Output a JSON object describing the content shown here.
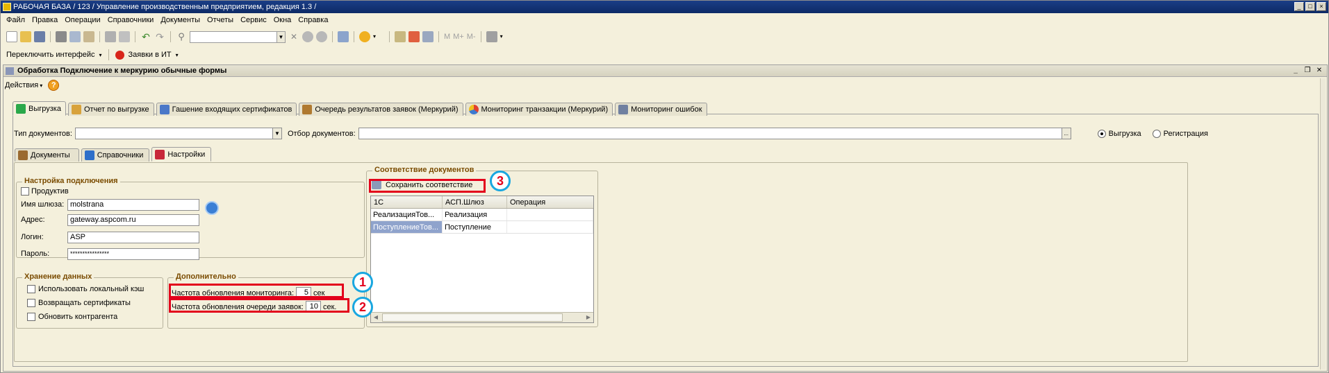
{
  "window": {
    "title": "РАБОЧАЯ БАЗА / 123 / Управление производственным предприятием, редакция 1.3 /"
  },
  "menu": [
    "Файл",
    "Правка",
    "Операции",
    "Справочники",
    "Документы",
    "Отчеты",
    "Сервис",
    "Окна",
    "Справка"
  ],
  "toolbar2": {
    "switch_interface": "Переключить интерфейс",
    "requests_it": "Заявки в ИТ"
  },
  "toolbar_disabled": {
    "m": "M",
    "mplus": "M+",
    "mminus": "M-"
  },
  "document": {
    "title": "Обработка  Подключение к меркурию обычные формы",
    "actions_label": "Действия"
  },
  "top_tabs": [
    {
      "label": "Выгрузка",
      "icon": "export-icon",
      "color": "#2aa84a"
    },
    {
      "label": "Отчет по выгрузке",
      "icon": "report-icon",
      "color": "#d8a23b"
    },
    {
      "label": "Гашение входящих сертификатов",
      "icon": "certificates-icon",
      "color": "#4b78c8"
    },
    {
      "label": "Очередь результатов заявок (Меркурий)",
      "icon": "queue-icon",
      "color": "#b07a30"
    },
    {
      "label": "Мониторинг транзакции (Меркурий)",
      "icon": "pie-chart-icon",
      "color": "#e04030"
    },
    {
      "label": "Мониторинг ошибок",
      "icon": "monitor-icon",
      "color": "#7080a0"
    }
  ],
  "filters": {
    "doc_type_label": "Тип документов:",
    "doc_type_value": "",
    "doc_filter_label": "Отбор документов:",
    "doc_filter_value": "",
    "radio_export": "Выгрузка",
    "radio_register": "Регистрация",
    "selected": "export"
  },
  "sub_tabs": [
    {
      "label": "Документы",
      "icon": "briefcase-icon",
      "color": "#9a6a30"
    },
    {
      "label": "Справочники",
      "icon": "directory-icon",
      "color": "#2e6fc9"
    },
    {
      "label": "Настройки",
      "icon": "settings-icon",
      "color": "#c8283a"
    }
  ],
  "connection": {
    "group_title": "Настройка подключения",
    "productive_label": "Продуктив",
    "productive_checked": false,
    "gateway_label": "Имя шлюза:",
    "gateway_value": "molstrana",
    "address_label": "Адрес:",
    "address_value": "gateway.aspcom.ru",
    "login_label": "Логин:",
    "login_value": "ASP",
    "password_label": "Пароль:",
    "password_value": "****************"
  },
  "storage": {
    "group_title": "Хранение данных",
    "items": [
      {
        "label": "Использовать локальный кэш",
        "checked": false
      },
      {
        "label": "Возвращать сертификаты",
        "checked": false
      },
      {
        "label": "Обновить контрагента",
        "checked": false
      }
    ]
  },
  "additional": {
    "group_title": "Дополнительно",
    "monitor_freq_label": "Частота обновления мониторинга:",
    "monitor_freq_value": "5",
    "monitor_freq_unit": "сек",
    "queue_freq_label": "Частота обновления очереди заявок:",
    "queue_freq_value": "10",
    "queue_freq_unit": "сек."
  },
  "mapping": {
    "group_title": "Соответствие документов",
    "save_button": "Сохранить соответствие",
    "columns": [
      "1С",
      "АСП.Шлюз",
      "Операция"
    ],
    "rows": [
      [
        "РеализацияТов...",
        "Реализация",
        ""
      ],
      [
        "ПоступлениеТов...",
        "Поступление",
        ""
      ]
    ]
  },
  "annotations": [
    "1",
    "2",
    "3"
  ],
  "colors": {
    "highlight": "#e3001b",
    "badge_border": "#19a7e0",
    "group_title": "#7a4b00",
    "titlebar": "#1a3e86"
  }
}
